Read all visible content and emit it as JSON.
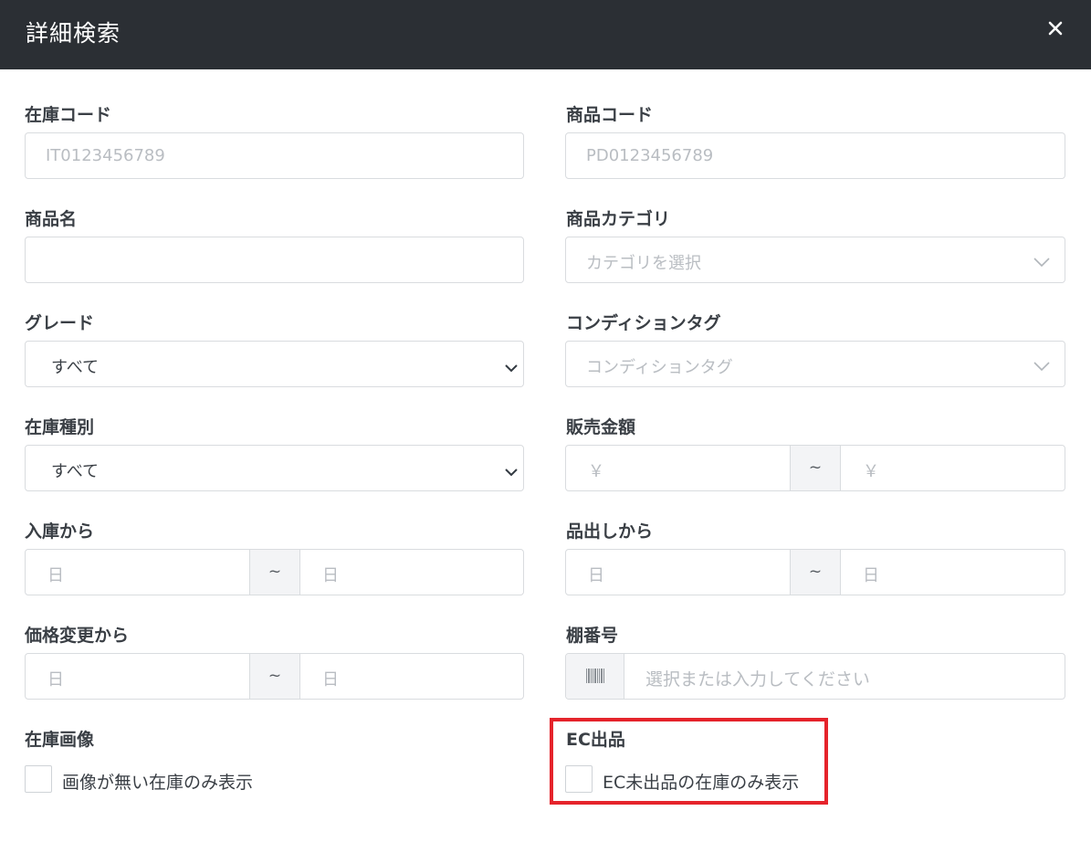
{
  "header": {
    "title": "詳細検索",
    "close_icon": "close-icon"
  },
  "fields": {
    "stock_code": {
      "label": "在庫コード",
      "placeholder": "IT0123456789"
    },
    "product_code": {
      "label": "商品コード",
      "placeholder": "PD0123456789"
    },
    "product_name": {
      "label": "商品名",
      "value": ""
    },
    "product_category": {
      "label": "商品カテゴリ",
      "placeholder": "カテゴリを選択"
    },
    "grade": {
      "label": "グレード",
      "selected": "すべて"
    },
    "condition_tag": {
      "label": "コンディションタグ",
      "placeholder": "コンディションタグ"
    },
    "stock_type": {
      "label": "在庫種別",
      "selected": "すべて"
    },
    "sales_price": {
      "label": "販売金額",
      "from_placeholder": "￥",
      "separator": "~",
      "to_placeholder": "￥"
    },
    "received_from": {
      "label": "入庫から",
      "from_placeholder": "日",
      "separator": "~",
      "to_placeholder": "日"
    },
    "listed_from": {
      "label": "品出しから",
      "from_placeholder": "日",
      "separator": "~",
      "to_placeholder": "日"
    },
    "price_changed_from": {
      "label": "価格変更から",
      "from_placeholder": "日",
      "separator": "~",
      "to_placeholder": "日"
    },
    "shelf_number": {
      "label": "棚番号",
      "placeholder": "選択または入力してください",
      "icon": "barcode-icon"
    },
    "stock_image": {
      "label": "在庫画像",
      "checkbox_label": "画像が無い在庫のみ表示",
      "checked": false
    },
    "ec_listing": {
      "label": "EC出品",
      "checkbox_label": "EC未出品の在庫のみ表示",
      "checked": false
    }
  },
  "colors": {
    "header_bg": "#2b2f34",
    "highlight": "#e5232b",
    "border": "#d9dcdf",
    "addon_bg": "#f3f4f6"
  }
}
